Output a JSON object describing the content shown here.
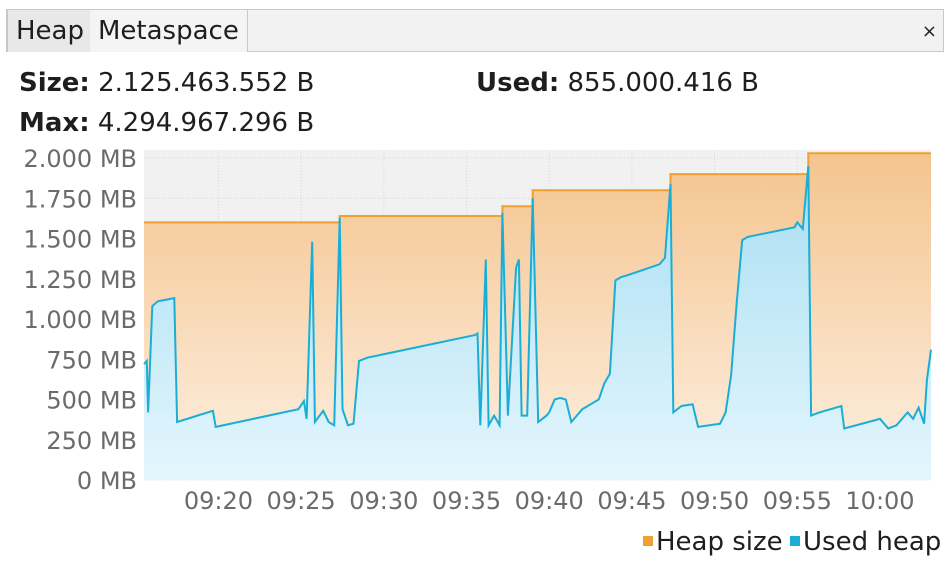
{
  "tabs": [
    {
      "label": "Heap",
      "active": true
    },
    {
      "label": "Metaspace",
      "active": false
    }
  ],
  "close_icon": "×",
  "stats": {
    "size_label": "Size:",
    "size_value": "2.125.463.552 B",
    "used_label": "Used:",
    "used_value": "855.000.416 B",
    "max_label": "Max:",
    "max_value": "4.294.967.296 B"
  },
  "colors": {
    "heap_line": "#f0a030",
    "used_line": "#1aaed6",
    "plot_bg": "#f1f1f1",
    "grid": "#d6d6d6"
  },
  "chart_data": {
    "type": "area",
    "y_unit": "MB",
    "ylim": [
      0,
      2050
    ],
    "xlim": [
      "09:15:30",
      "10:03:05"
    ],
    "y_ticks": [
      {
        "value": 0,
        "label": "0 MB"
      },
      {
        "value": 250,
        "label": "250 MB"
      },
      {
        "value": 500,
        "label": "500 MB"
      },
      {
        "value": 750,
        "label": "750 MB"
      },
      {
        "value": 1000,
        "label": "1.000 MB"
      },
      {
        "value": 1250,
        "label": "1.250 MB"
      },
      {
        "value": 1500,
        "label": "1.500 MB"
      },
      {
        "value": 1750,
        "label": "1.750 MB"
      },
      {
        "value": 2000,
        "label": "2.000 MB"
      }
    ],
    "x_ticks": [
      "09:20",
      "09:25",
      "09:30",
      "09:35",
      "09:40",
      "09:45",
      "09:50",
      "09:55",
      "10:00"
    ],
    "grid": true,
    "legend_position": "bottom-right",
    "series": [
      {
        "name": "Heap size",
        "color": "#f0a030",
        "step": true,
        "points": [
          [
            "09:15:30",
            1600
          ],
          [
            "09:27:20",
            1600
          ],
          [
            "09:27:20",
            1640
          ],
          [
            "09:37:10",
            1640
          ],
          [
            "09:37:10",
            1700
          ],
          [
            "09:39:00",
            1700
          ],
          [
            "09:39:00",
            1800
          ],
          [
            "09:47:20",
            1800
          ],
          [
            "09:47:20",
            1900
          ],
          [
            "09:55:40",
            1900
          ],
          [
            "09:55:40",
            2030
          ],
          [
            "10:03:05",
            2030
          ]
        ]
      },
      {
        "name": "Used heap",
        "color": "#1aaed6",
        "points": [
          [
            "09:15:30",
            720
          ],
          [
            "09:15:40",
            740
          ],
          [
            "09:15:45",
            420
          ],
          [
            "09:16:00",
            1080
          ],
          [
            "09:16:20",
            1110
          ],
          [
            "09:17:20",
            1130
          ],
          [
            "09:17:30",
            360
          ],
          [
            "09:19:40",
            430
          ],
          [
            "09:19:50",
            330
          ],
          [
            "09:24:50",
            440
          ],
          [
            "09:25:10",
            490
          ],
          [
            "09:25:20",
            380
          ],
          [
            "09:25:40",
            1480
          ],
          [
            "09:25:50",
            360
          ],
          [
            "09:26:20",
            430
          ],
          [
            "09:26:40",
            360
          ],
          [
            "09:27:00",
            340
          ],
          [
            "09:27:20",
            1630
          ],
          [
            "09:27:30",
            440
          ],
          [
            "09:27:50",
            340
          ],
          [
            "09:28:10",
            350
          ],
          [
            "09:28:30",
            740
          ],
          [
            "09:29:00",
            760
          ],
          [
            "09:35:30",
            900
          ],
          [
            "09:35:40",
            910
          ],
          [
            "09:35:50",
            340
          ],
          [
            "09:36:10",
            1370
          ],
          [
            "09:36:20",
            340
          ],
          [
            "09:36:40",
            400
          ],
          [
            "09:37:00",
            340
          ],
          [
            "09:37:10",
            1660
          ],
          [
            "09:37:30",
            400
          ],
          [
            "09:38:00",
            1320
          ],
          [
            "09:38:10",
            1370
          ],
          [
            "09:38:20",
            400
          ],
          [
            "09:38:40",
            400
          ],
          [
            "09:39:00",
            1750
          ],
          [
            "09:39:20",
            360
          ],
          [
            "09:39:50",
            400
          ],
          [
            "09:40:00",
            420
          ],
          [
            "09:40:20",
            500
          ],
          [
            "09:40:40",
            510
          ],
          [
            "09:41:00",
            500
          ],
          [
            "09:41:20",
            360
          ],
          [
            "09:41:40",
            400
          ],
          [
            "09:42:00",
            440
          ],
          [
            "09:42:20",
            460
          ],
          [
            "09:42:40",
            480
          ],
          [
            "09:43:00",
            500
          ],
          [
            "09:43:20",
            600
          ],
          [
            "09:43:40",
            660
          ],
          [
            "09:44:00",
            1240
          ],
          [
            "09:44:20",
            1260
          ],
          [
            "09:44:40",
            1270
          ],
          [
            "09:46:40",
            1340
          ],
          [
            "09:47:00",
            1380
          ],
          [
            "09:47:20",
            1840
          ],
          [
            "09:47:30",
            420
          ],
          [
            "09:48:00",
            460
          ],
          [
            "09:48:40",
            470
          ],
          [
            "09:49:00",
            330
          ],
          [
            "09:50:20",
            350
          ],
          [
            "09:50:40",
            420
          ],
          [
            "09:51:00",
            650
          ],
          [
            "09:51:20",
            1100
          ],
          [
            "09:51:40",
            1490
          ],
          [
            "09:52:00",
            1510
          ],
          [
            "09:54:50",
            1570
          ],
          [
            "09:55:00",
            1600
          ],
          [
            "09:55:20",
            1560
          ],
          [
            "09:55:40",
            1950
          ],
          [
            "09:55:50",
            400
          ],
          [
            "09:56:20",
            420
          ],
          [
            "09:57:40",
            460
          ],
          [
            "09:57:50",
            320
          ],
          [
            "09:59:40",
            370
          ],
          [
            "10:00:00",
            380
          ],
          [
            "10:00:30",
            320
          ],
          [
            "10:01:00",
            340
          ],
          [
            "10:01:40",
            420
          ],
          [
            "10:02:00",
            380
          ],
          [
            "10:02:20",
            450
          ],
          [
            "10:02:40",
            350
          ],
          [
            "10:02:50",
            620
          ],
          [
            "10:03:05",
            810
          ]
        ]
      }
    ]
  }
}
